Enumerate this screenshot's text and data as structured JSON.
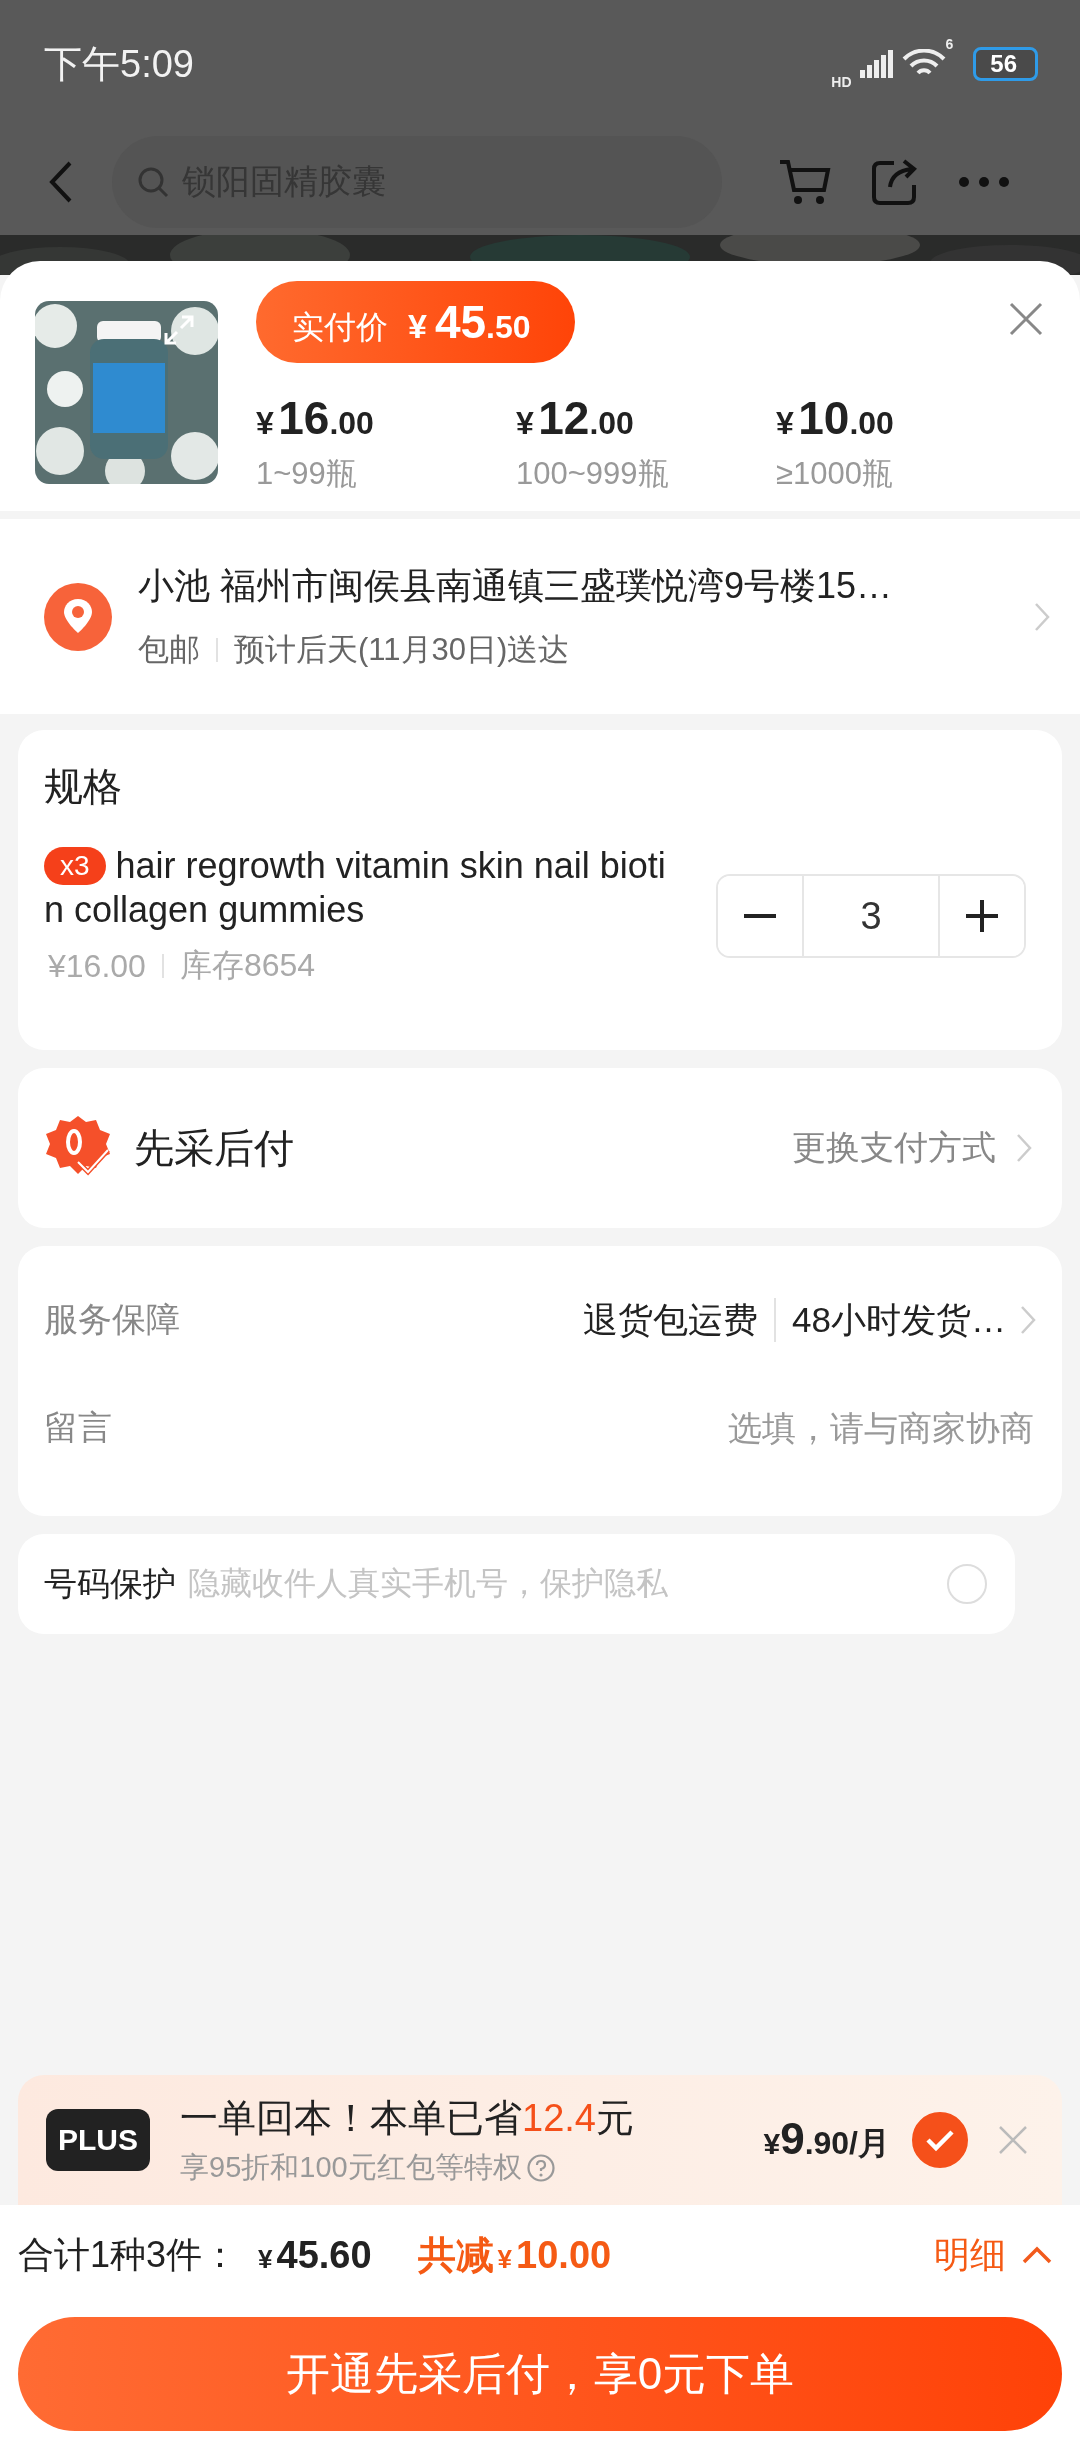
{
  "status_bar": {
    "time": "下午5:09",
    "network": "HD",
    "wifi_label": "6",
    "battery": "56"
  },
  "nav": {
    "search_placeholder": "锁阳固精胶囊"
  },
  "product": {
    "paid_label": "实付价",
    "paid_price": {
      "currency": "¥",
      "integer": "45",
      "decimal": ".50"
    },
    "tiers": [
      {
        "currency": "¥",
        "integer": "16",
        "decimal": ".00",
        "range": "1~99瓶"
      },
      {
        "currency": "¥",
        "integer": "12",
        "decimal": ".00",
        "range": "100~999瓶"
      },
      {
        "currency": "¥",
        "integer": "10",
        "decimal": ".00",
        "range": "≥1000瓶"
      }
    ]
  },
  "address": {
    "text": "小池 福州市闽侯县南通镇三盛璞悦湾9号楼15…",
    "shipping": "包邮",
    "delivery": "预计后天(11月30日)送达"
  },
  "spec": {
    "title": "规格",
    "count_badge": "x3",
    "name": "hair regrowth vitamin skin nail biotin collagen gummies",
    "price": "¥16.00",
    "stock": "库存8654",
    "quantity": "3"
  },
  "payment": {
    "title": "先采后付",
    "change": "更换支付方式"
  },
  "service": {
    "label": "服务保障",
    "tags": [
      "退货包运费",
      "48小时发货…"
    ]
  },
  "message": {
    "label": "留言",
    "placeholder": "选填，请与商家协商"
  },
  "phone_protection": {
    "label": "号码保护",
    "description": "隐藏收件人真实手机号，保护隐私",
    "checked": false
  },
  "plus": {
    "badge": "PLUS",
    "headline_prefix": "一单回本！本单已省",
    "saved": "12.4",
    "headline_suffix": "元",
    "subline": "享95折和100元红包等特权",
    "price": {
      "currency": "¥",
      "integer": "9",
      "decimal": ".90",
      "unit": "/月"
    },
    "checked": true
  },
  "summary": {
    "total_label": "合计1种3件：",
    "total": {
      "currency": "¥",
      "value": "45.60"
    },
    "discount_label": "共减",
    "discount": {
      "currency": "¥",
      "value": "10.00"
    },
    "details": "明细"
  },
  "submit": "开通先采后付，享0元下单"
}
